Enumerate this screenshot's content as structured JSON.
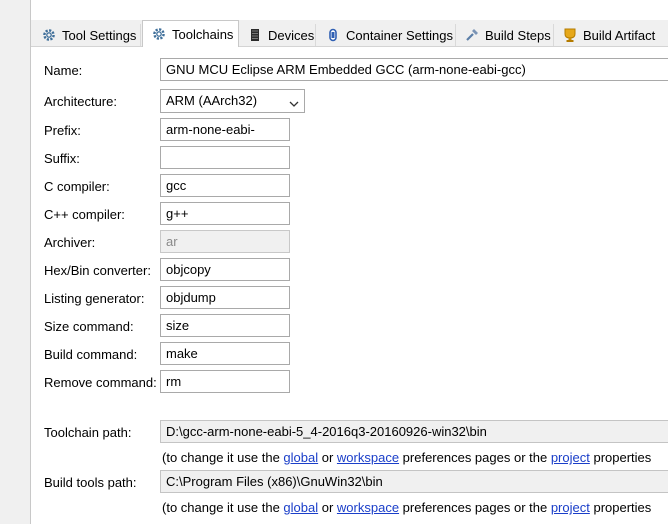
{
  "tabs": [
    {
      "label": "Tool Settings",
      "icon": "gear-icon"
    },
    {
      "label": "Toolchains",
      "icon": "gear-icon"
    },
    {
      "label": "Devices",
      "icon": "device-icon"
    },
    {
      "label": "Container Settings",
      "icon": "container-icon"
    },
    {
      "label": "Build Steps",
      "icon": "build-steps-icon"
    },
    {
      "label": "Build Artifact",
      "icon": "artifact-icon"
    }
  ],
  "active_tab": "Toolchains",
  "form": {
    "name": {
      "label": "Name:",
      "value": "GNU MCU Eclipse ARM Embedded GCC (arm-none-eabi-gcc)"
    },
    "architecture": {
      "label": "Architecture:",
      "value": "ARM (AArch32)"
    },
    "prefix": {
      "label": "Prefix:",
      "value": "arm-none-eabi-"
    },
    "suffix": {
      "label": "Suffix:",
      "value": ""
    },
    "c_compiler": {
      "label": "C compiler:",
      "value": "gcc"
    },
    "cpp_compiler": {
      "label": "C++ compiler:",
      "value": "g++"
    },
    "archiver": {
      "label": "Archiver:",
      "value": "ar"
    },
    "hexbin": {
      "label": "Hex/Bin converter:",
      "value": "objcopy"
    },
    "listing": {
      "label": "Listing generator:",
      "value": "objdump"
    },
    "size": {
      "label": "Size command:",
      "value": "size"
    },
    "build": {
      "label": "Build command:",
      "value": "make"
    },
    "remove": {
      "label": "Remove command:",
      "value": "rm"
    },
    "toolchain_path": {
      "label": "Toolchain path:",
      "value": "D:\\gcc-arm-none-eabi-5_4-2016q3-20160926-win32\\bin"
    },
    "build_tools_path": {
      "label": "Build tools path:",
      "value": "C:\\Program Files (x86)\\GnuWin32\\bin"
    }
  },
  "note": {
    "prefix": "(to change it use the ",
    "global": "global",
    "or1": " or ",
    "workspace": "workspace",
    "middle": " preferences pages or the ",
    "project": "project",
    "suffix": " properties"
  },
  "colors": {
    "link": "#1a3ec9",
    "tab_bg": "#f0f0f0",
    "border": "#a9a9a9"
  }
}
